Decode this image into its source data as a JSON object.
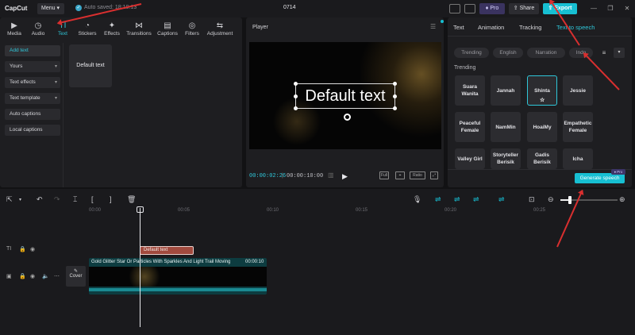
{
  "titlebar": {
    "logo": "CapCut",
    "menu": "Menu",
    "autosave": "Auto saved: 18:10:13",
    "project_name": "0714",
    "pro": "Pro",
    "share": "Share",
    "export": "Export"
  },
  "toolbar": [
    {
      "label": "Media",
      "icon": "media-icon"
    },
    {
      "label": "Audio",
      "icon": "audio-icon"
    },
    {
      "label": "Text",
      "icon": "text-icon"
    },
    {
      "label": "Stickers",
      "icon": "stickers-icon"
    },
    {
      "label": "Effects",
      "icon": "effects-icon"
    },
    {
      "label": "Transitions",
      "icon": "transitions-icon"
    },
    {
      "label": "Captions",
      "icon": "captions-icon"
    },
    {
      "label": "Filters",
      "icon": "filters-icon"
    },
    {
      "label": "Adjustment",
      "icon": "adjustment-icon"
    }
  ],
  "sidebar": {
    "items": [
      {
        "label": "Add text"
      },
      {
        "label": "Yours"
      },
      {
        "label": "Text effects"
      },
      {
        "label": "Text template"
      },
      {
        "label": "Auto captions"
      },
      {
        "label": "Local captions"
      }
    ]
  },
  "text_card": "Default text",
  "player": {
    "title": "Player",
    "overlay_text": "Default text",
    "current_time": "00:00:02:26",
    "total_time": "00:00:10:00",
    "full_label": "Full",
    "ratio_label": "Ratio"
  },
  "right_panel": {
    "tabs": [
      "Text",
      "Animation",
      "Tracking",
      "Text to speech"
    ],
    "chips": [
      "Trending",
      "English",
      "Narration",
      "Indo"
    ],
    "trending_label": "Trending",
    "voices": [
      "Suara Wanita",
      "Jannah",
      "Shinta",
      "Jessie",
      "Peaceful Female",
      "NamMin",
      "HoaiMy",
      "Empathetic Female",
      "Valley Girl",
      "Storyteller Berisik",
      "Gadis Berisik",
      "Icha"
    ],
    "generate": "Generate speech",
    "pro_badge": "Pro"
  },
  "timeline": {
    "ruler": [
      "00:00",
      "00:05",
      "00:10",
      "00:15",
      "00:20",
      "00:25"
    ],
    "text_clip": "Default text",
    "video_clip_label": "Gold Glitter Star Or Particles With Sparkles And Light Trail Moving",
    "video_clip_duration": "00:00:10",
    "cover": "Cover"
  },
  "colors": {
    "accent": "#17bfd2",
    "annotation_arrow": "#d92f2f",
    "text_clip": "#a14a3e",
    "video_clip": "#0d3c40"
  }
}
